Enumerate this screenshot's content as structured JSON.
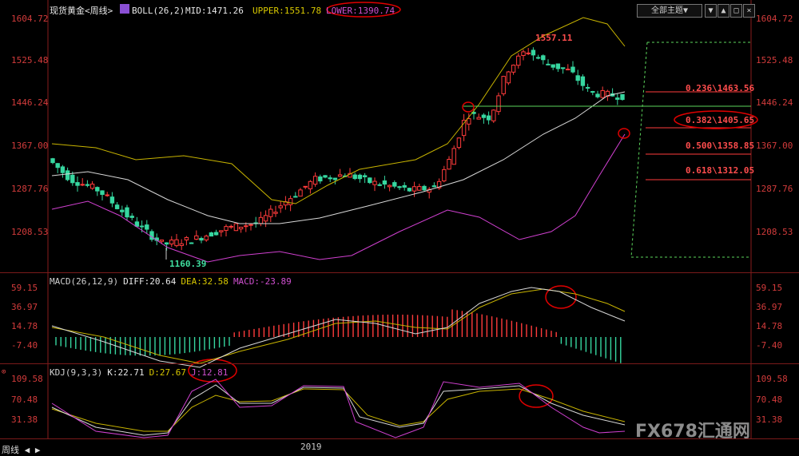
{
  "header": {
    "symbol": "现货黄金<周线>",
    "indicator": "BOLL(26,2)",
    "mid": "MID:1471.26",
    "upper": "UPPER:1551.78",
    "lower": "LOWER:1390.74",
    "theme_button": "全部主题▼"
  },
  "price_axis": {
    "ticks": [
      "1604.72",
      "1525.48",
      "1446.24",
      "1367.00",
      "1287.76",
      "1208.53"
    ]
  },
  "annotations": {
    "high": "1557.11",
    "low": "1160.39"
  },
  "fibonacci": [
    {
      "label": "0.236\\1463.56"
    },
    {
      "label": "0.382\\1405.65"
    },
    {
      "label": "0.500\\1358.85"
    },
    {
      "label": "0.618\\1312.05"
    }
  ],
  "macd": {
    "title": "MACD(26,12,9)",
    "diff": "DIFF:20.64",
    "dea": "DEA:32.58",
    "macd": "MACD:-23.89",
    "ticks": [
      "59.15",
      "36.97",
      "14.78",
      "-7.40"
    ]
  },
  "kdj": {
    "title": "KDJ(9,3,3)",
    "k": "K:22.71",
    "d": "D:27.67",
    "j": "J:12.81",
    "ticks": [
      "109.58",
      "70.48",
      "31.38"
    ]
  },
  "time_axis": {
    "year": "2019"
  },
  "bottom_tab": "周线",
  "watermark": "FX678汇通网",
  "colors": {
    "up": "#ff3b3b",
    "down": "#36d7a0",
    "mid_line": "#d8d8d8",
    "upper_line": "#c8b400",
    "lower_line": "#d040d0",
    "fib_line": "#ff3b3b",
    "support_line": "#5cd65c",
    "highlight": "#e00000"
  }
}
